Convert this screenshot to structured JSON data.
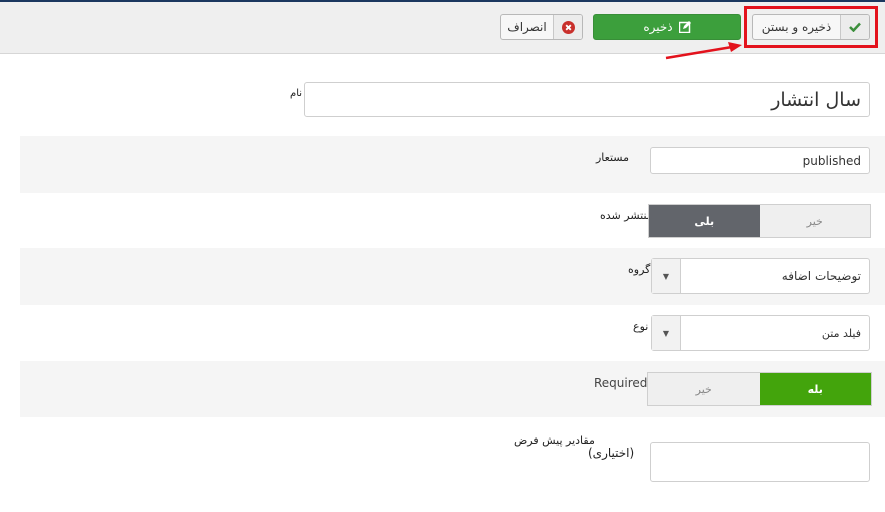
{
  "toolbar": {
    "cancel_label": "انصراف",
    "save_label": "ذخیره",
    "save_close_label": "ذخیره و بستن",
    "icons": {
      "cancel": "close-circle-icon",
      "save": "edit-icon",
      "save_close": "check-icon"
    }
  },
  "form": {
    "name": {
      "label": "نام",
      "value": "سال انتشار"
    },
    "alias": {
      "label": "مستعار",
      "value": "published"
    },
    "published": {
      "label": "منتشر شده",
      "yes": "بلی",
      "no": "خیر",
      "selected": "yes"
    },
    "group": {
      "label": "گروه",
      "value": "توضیحات اضافه"
    },
    "type": {
      "label": "نوع",
      "value": "فیلد متن"
    },
    "required": {
      "label": "Required",
      "yes": "بله",
      "no": "خیر",
      "selected": "yes"
    },
    "default_values": {
      "label_line1": "مقادیر پیش فرض",
      "label_line2": "(اختیاری)",
      "value": ""
    }
  },
  "colors": {
    "success": "#3c9f3c",
    "toggle_active_dark": "#62656b",
    "toggle_active_green": "#43a40c",
    "highlight": "#e3121c",
    "topbar": "#1b375f"
  }
}
